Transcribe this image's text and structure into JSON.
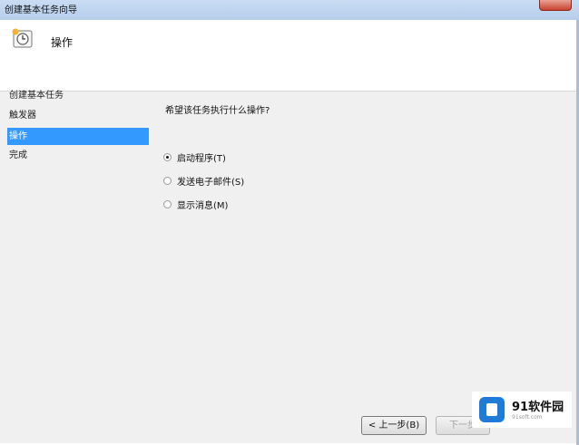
{
  "window": {
    "title": "创建基本任务向导"
  },
  "header": {
    "title": "操作",
    "icon": "clock-task-icon"
  },
  "sidebar": {
    "items": [
      {
        "label": "创建基本任务",
        "active": false
      },
      {
        "label": "触发器",
        "active": false
      },
      {
        "label": "操作",
        "active": true
      },
      {
        "label": "完成",
        "active": false
      }
    ]
  },
  "main": {
    "question": "希望该任务执行什么操作?",
    "options": [
      {
        "label": "启动程序(T)",
        "checked": true
      },
      {
        "label": "发送电子邮件(S)",
        "checked": false
      },
      {
        "label": "显示消息(M)",
        "checked": false
      }
    ]
  },
  "buttons": {
    "back": "< 上一步(B)",
    "next": "下一步"
  },
  "watermark": {
    "brand": "91软件园",
    "url": "91soft.com"
  },
  "colors": {
    "selection": "#3399ff",
    "panel": "#f0f0f0",
    "titlebar": "#c9dcf3"
  }
}
